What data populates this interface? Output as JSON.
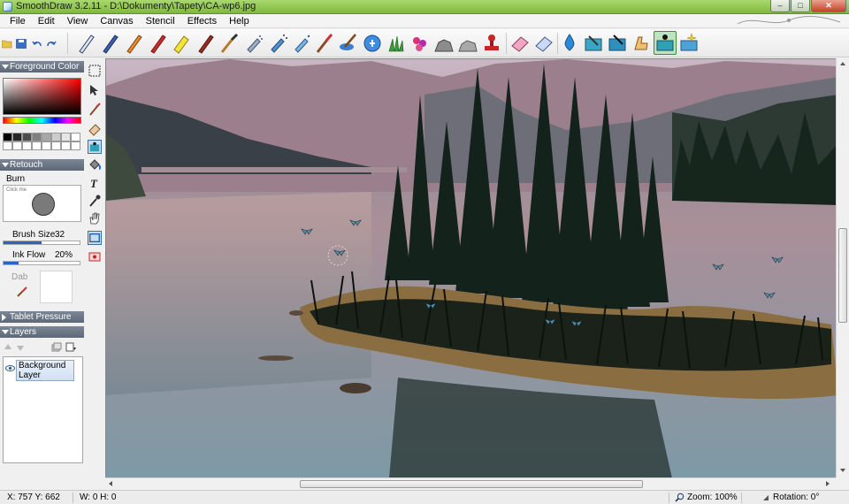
{
  "window": {
    "title": "SmoothDraw 3.2.11 - D:\\Dokumenty\\Tapety\\CA-wp6.jpg",
    "minimize": "–",
    "maximize": "□",
    "close": "✕"
  },
  "menu": [
    "File",
    "Edit",
    "View",
    "Canvas",
    "Stencil",
    "Effects",
    "Help"
  ],
  "toolbar": {
    "file_icons": [
      "open-folder-icon",
      "save-icon",
      "undo-icon",
      "redo-icon"
    ],
    "brush_tools": [
      "pen-icon",
      "pencil-icon",
      "crayon-icon",
      "red-crayon-icon",
      "highlighter-icon",
      "marker-icon",
      "oil-brush-icon",
      "airbrush-icon",
      "spray-icon",
      "spray-blue-icon",
      "paint-brush-icon",
      "water-brush-icon",
      "blur-icon",
      "grass-icon",
      "flowers-icon",
      "rock-icon",
      "stone-icon",
      "stamp-icon",
      "eraser-icon",
      "soft-eraser-icon",
      "water-drop-icon",
      "smudge-icon",
      "blend-icon",
      "finger-icon",
      "image-hose-icon",
      "sparkle-icon"
    ]
  },
  "panels": {
    "foreground_color": "Foreground Color",
    "retouch": "Retouch",
    "tablet_pressure": "Tablet Pressure",
    "layers": "Layers"
  },
  "colors": {
    "accent": "#2b64c8",
    "swatches": [
      "#000000",
      "#262626",
      "#4d4d4d",
      "#808080",
      "#a6a6a6",
      "#cccccc",
      "#e6e6e6",
      "#ffffff",
      "#ffffff",
      "#ffffff",
      "#ffffff",
      "#ffffff",
      "#ffffff",
      "#ffffff",
      "#ffffff",
      "#ffffff"
    ]
  },
  "retouch": {
    "brush_name": "Burn",
    "preview_hint": "Click me",
    "brush_size_label": "Brush Size",
    "brush_size_value": "32",
    "brush_size_fraction": 0.5,
    "ink_flow_label": "Ink Flow",
    "ink_flow_value": "20%",
    "ink_flow_fraction": 0.2,
    "dab_label": "Dab"
  },
  "layers": {
    "items": [
      {
        "name": "Background Layer",
        "visible": true
      }
    ]
  },
  "tool_column": [
    "select-rect-icon",
    "move-icon",
    "brush-tool-icon",
    "eraser-tool-icon",
    "image-tool-icon",
    "fill-icon",
    "text-icon",
    "eyedropper-icon",
    "hand-icon",
    "rectangle-icon",
    "red-rect-icon"
  ],
  "status": {
    "coords": "X: 757 Y: 662",
    "size": "W: 0 H: 0",
    "zoom": "Zoom: 100%",
    "rotation": "Rotation: 0°"
  }
}
